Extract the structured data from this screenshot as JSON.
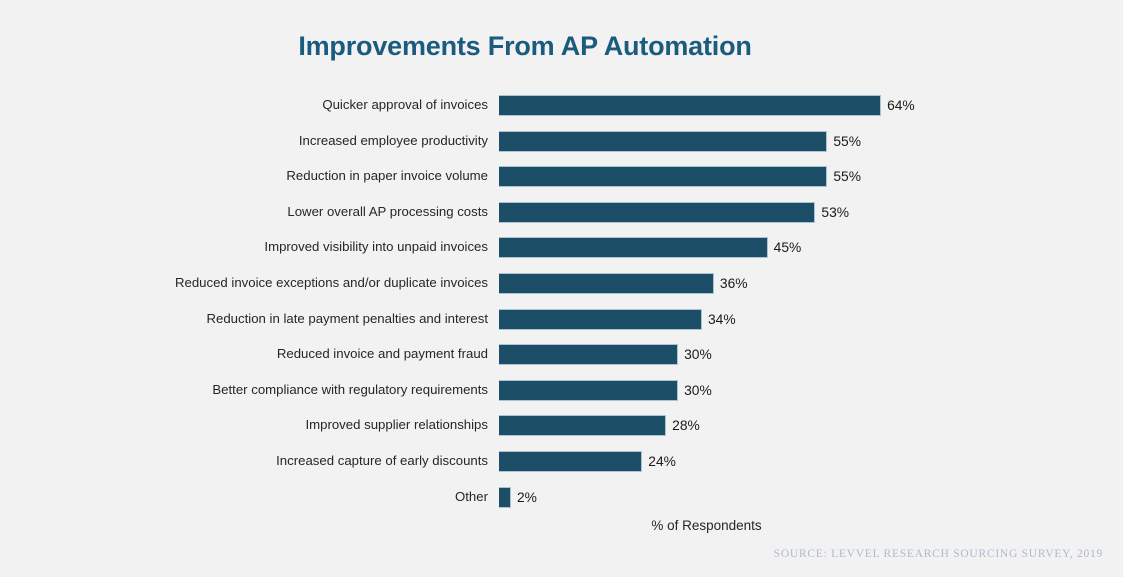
{
  "chart_data": {
    "type": "bar",
    "orientation": "horizontal",
    "title": "Improvements From AP Automation",
    "xlabel": "% of Respondents",
    "ylabel": "",
    "grid": false,
    "legend": null,
    "xlim": [
      0,
      64
    ],
    "value_suffix": "%",
    "bar_color": "#1d4e68",
    "title_color": "#1b5b7e",
    "background_color": "#f2f2f2",
    "categories": [
      "Quicker approval of invoices",
      "Increased employee productivity",
      "Reduction in paper invoice volume",
      "Lower overall AP processing costs",
      "Improved visibility into unpaid invoices",
      "Reduced invoice exceptions and/or duplicate invoices",
      "Reduction in late payment penalties and interest",
      "Reduced invoice and payment fraud",
      "Better compliance with regulatory requirements",
      "Improved supplier relationships",
      "Increased capture of early discounts",
      "Other"
    ],
    "values": [
      64,
      55,
      55,
      53,
      45,
      36,
      34,
      30,
      30,
      28,
      24,
      2
    ],
    "value_labels": [
      "64%",
      "55%",
      "55%",
      "53%",
      "45%",
      "36%",
      "34%",
      "30%",
      "30%",
      "28%",
      "24%",
      "2%"
    ],
    "annotations": [
      "SOURCE: LEVVEL RESEARCH SOURCING SURVEY, 2019"
    ]
  },
  "footer": {
    "source": "SOURCE: LEVVEL RESEARCH SOURCING SURVEY, 2019"
  }
}
